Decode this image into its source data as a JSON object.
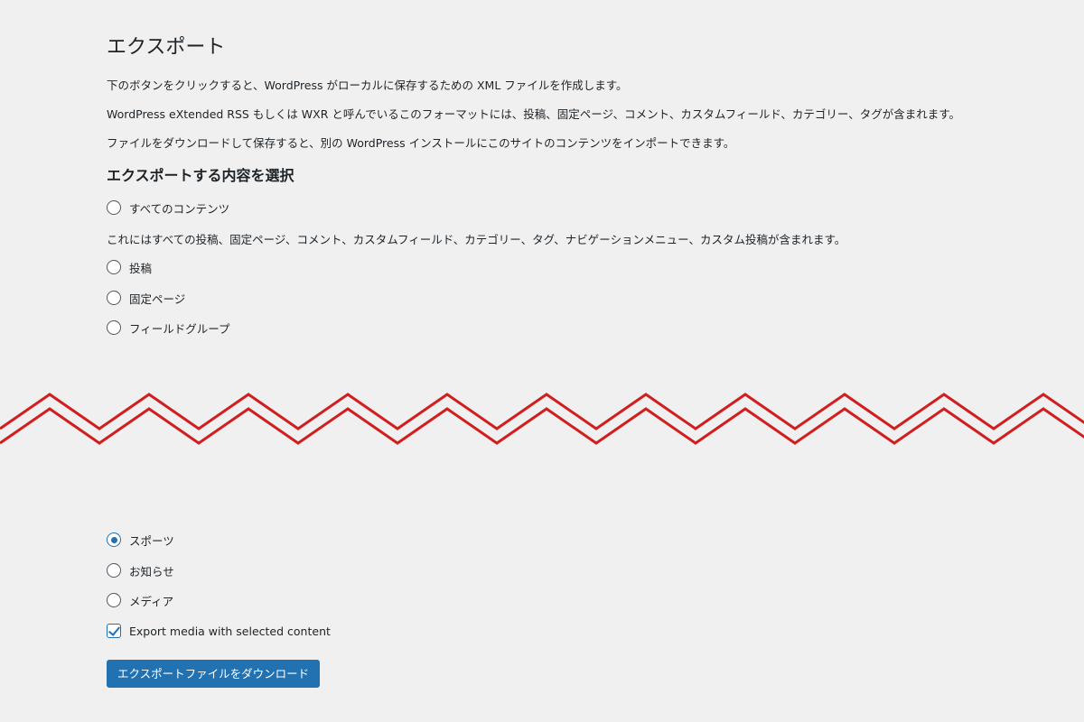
{
  "page": {
    "title": "エクスポート",
    "descriptions": [
      "下のボタンをクリックすると、WordPress がローカルに保存するための XML ファイルを作成します。",
      "WordPress eXtended RSS もしくは WXR と呼んでいるこのフォーマットには、投稿、固定ページ、コメント、カスタムフィールド、カテゴリー、タグが含まれます。",
      "ファイルをダウンロードして保存すると、別の WordPress インストールにこのサイトのコンテンツをインポートできます。"
    ]
  },
  "export_section": {
    "heading": "エクスポートする内容を選択",
    "all_content_label": "すべてのコンテンツ",
    "all_content_description": "これにはすべての投稿、固定ページ、コメント、カスタムフィールド、カテゴリー、タグ、ナビゲーションメニュー、カスタム投稿が含まれます。",
    "options_top": [
      {
        "label": "投稿",
        "checked": false
      },
      {
        "label": "固定ページ",
        "checked": false
      },
      {
        "label": "フィールドグループ",
        "checked": false
      }
    ],
    "options_bottom": [
      {
        "label": "スポーツ",
        "checked": true
      },
      {
        "label": "お知らせ",
        "checked": false
      },
      {
        "label": "メディア",
        "checked": false
      }
    ],
    "export_media": {
      "label": "Export media with selected content",
      "checked": true
    },
    "download_button_label": "エクスポートファイルをダウンロード"
  },
  "colors": {
    "background": "#f0f0f1",
    "accent": "#2271b1",
    "zigzag": "#d11f1f"
  }
}
